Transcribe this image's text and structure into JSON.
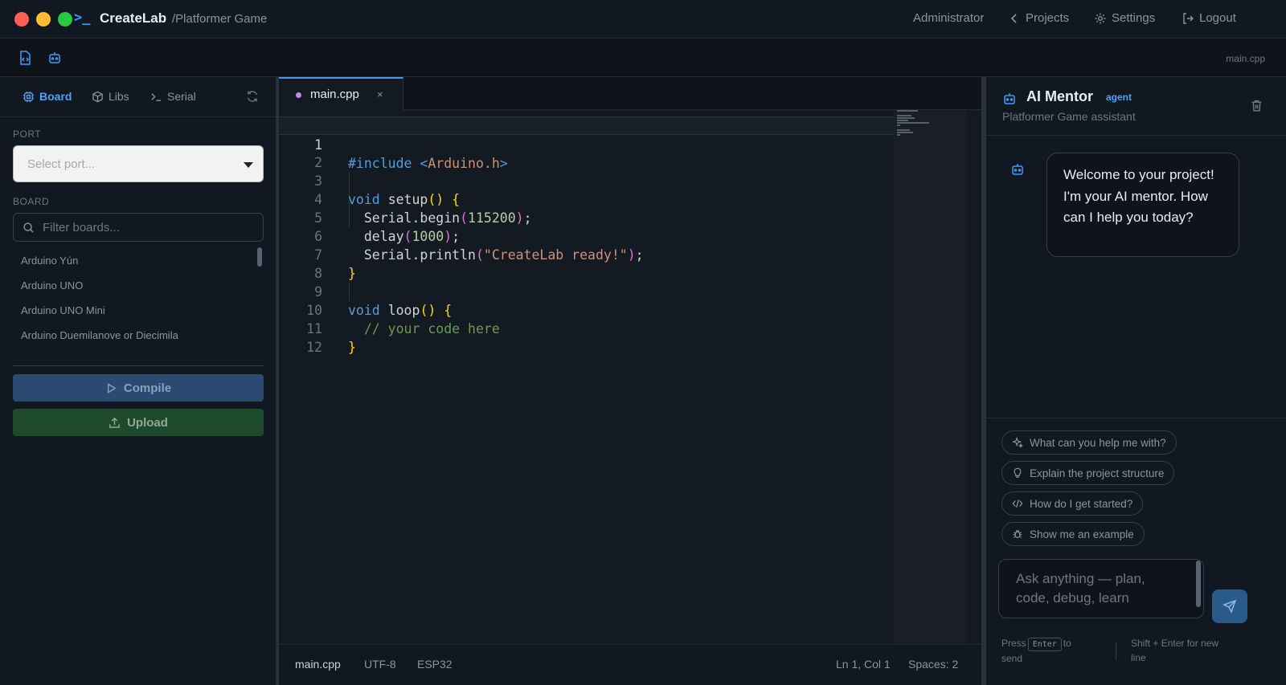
{
  "app": {
    "brand": "CreateLab",
    "project": "/Platformer Game",
    "logo_glyph": ">_",
    "nav": {
      "user": "Administrator",
      "projects": "Projects",
      "settings": "Settings",
      "logout": "Logout"
    }
  },
  "toolbar": {
    "icons": [
      "code-file-icon",
      "robot-icon"
    ],
    "current_file": "main.cpp"
  },
  "sidebar": {
    "tabs": [
      {
        "label": "Board",
        "icon": "chip-icon",
        "active": true
      },
      {
        "label": "Libs",
        "icon": "package-icon",
        "active": false
      },
      {
        "label": "Serial",
        "icon": "terminal-icon",
        "active": false
      }
    ],
    "port_label": "PORT",
    "port_placeholder": "Select port...",
    "board_label": "BOARD",
    "board_filter_placeholder": "Filter boards...",
    "boards": [
      "Arduino Yún",
      "Arduino UNO",
      "Arduino UNO Mini",
      "Arduino Duemilanove or Diecimila"
    ],
    "compile_label": "Compile",
    "upload_label": "Upload"
  },
  "editor": {
    "tab": {
      "name": "main.cpp",
      "close": "×",
      "modified": true
    },
    "current_line": 1,
    "lines": [
      "#include <Arduino.h>",
      "",
      "void setup() {",
      "  Serial.begin(115200);",
      "  delay(1000);",
      "  Serial.println(\"CreateLab ready!\");",
      "}",
      "",
      "void loop() {",
      "  // your code here",
      "}",
      ""
    ],
    "status": {
      "file": "main.cpp",
      "encoding": "UTF-8",
      "board": "ESP32",
      "position": "Ln 1, Col 1",
      "indent": "Spaces: 2"
    }
  },
  "mentor": {
    "title": "AI Mentor",
    "badge": "agent",
    "subtitle": "Platformer Game assistant",
    "welcome": "Welcome to your project! I'm your AI mentor. How can I help you today?",
    "suggestions": [
      {
        "label": "What can you help me with?",
        "icon": "sparkles-icon"
      },
      {
        "label": "Explain the project structure",
        "icon": "lightbulb-icon"
      },
      {
        "label": "How do I get started?",
        "icon": "code-icon"
      },
      {
        "label": "Show me an example",
        "icon": "bug-icon"
      }
    ],
    "input_placeholder": "Ask anything — plan, code, debug, learn",
    "hint_press": "Press",
    "hint_key": "Enter",
    "hint_to_send": "to send",
    "hint_newline": "Shift + Enter for new line"
  },
  "colors": {
    "accent": "#3b9eff",
    "background": "#0f141b",
    "panel": "#121821",
    "compile": "#2a4a72",
    "upload": "#1c4a2b"
  }
}
